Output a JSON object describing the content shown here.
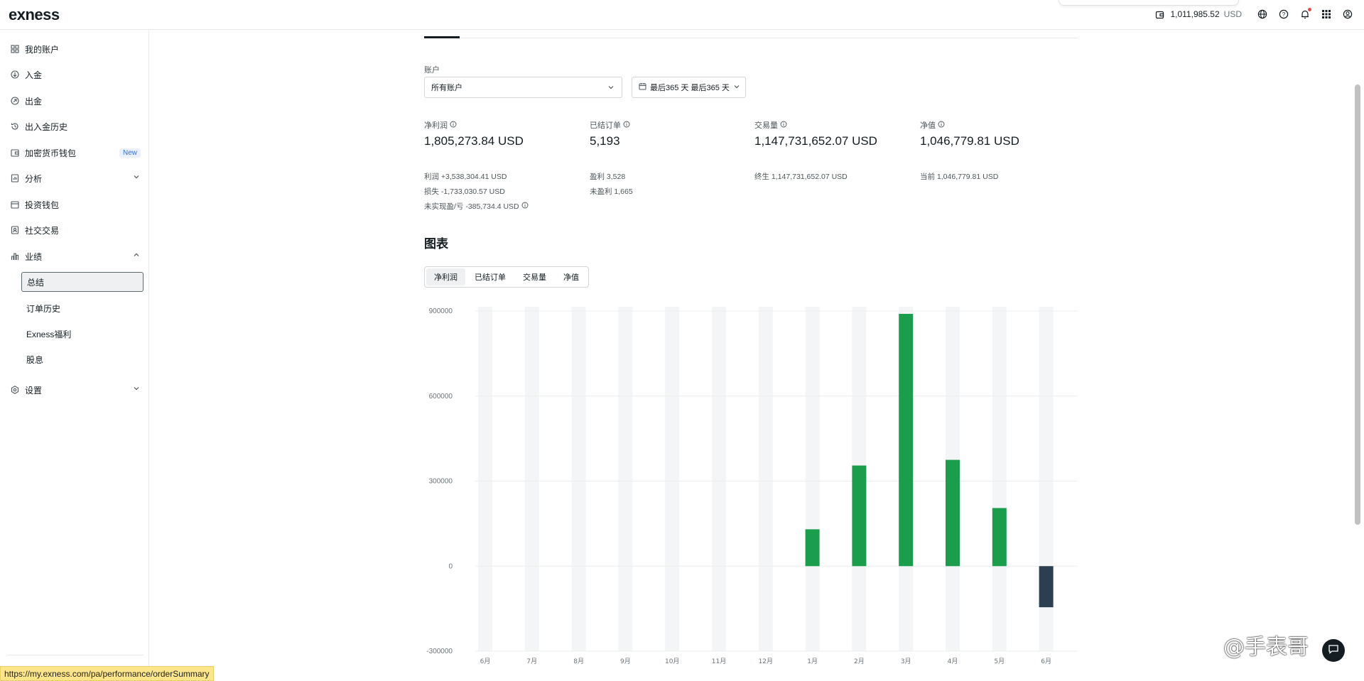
{
  "brand": "exness",
  "header": {
    "balance": "1,011,985.52",
    "currency": "USD",
    "icons": [
      "wallet-icon",
      "globe-icon",
      "help-icon",
      "bell-icon",
      "apps-grid-icon",
      "user-icon"
    ]
  },
  "sidebar": {
    "items": [
      {
        "label": "我的账户",
        "icon": "grid-icon"
      },
      {
        "label": "入金",
        "icon": "deposit-icon"
      },
      {
        "label": "出金",
        "icon": "withdraw-icon"
      },
      {
        "label": "出入金历史",
        "icon": "history-icon"
      },
      {
        "label": "加密货币钱包",
        "icon": "wallet-icon",
        "badge": "New"
      },
      {
        "label": "分析",
        "icon": "analysis-icon"
      },
      {
        "label": "投资钱包",
        "icon": "invest-wallet-icon"
      },
      {
        "label": "社交交易",
        "icon": "social-icon"
      },
      {
        "label": "业绩",
        "icon": "bar-chart-icon"
      },
      {
        "label": "设置",
        "icon": "settings-icon"
      }
    ],
    "sub_items": [
      "总结",
      "订单历史",
      "Exness福利",
      "股息"
    ]
  },
  "filters": {
    "account_label": "账户",
    "account_value": "所有账户",
    "date_range": "最后365 天 最后365 天"
  },
  "stats": {
    "net_profit": {
      "title": "净利润",
      "value": "1,805,273.84 USD",
      "lines": [
        "利润 +3,538,304.41 USD",
        "损失 -1,733,030.57 USD",
        "未实现盈/亏 -385,734.4 USD"
      ]
    },
    "closed_orders": {
      "title": "已结订单",
      "value": "5,193",
      "lines": [
        "盈利 3,528",
        "未盈利 1,665"
      ]
    },
    "volume": {
      "title": "交易量",
      "value": "1,147,731,652.07 USD",
      "lines": [
        "终生 1,147,731,652.07 USD"
      ]
    },
    "equity": {
      "title": "净值",
      "value": "1,046,779.81 USD",
      "lines": [
        "当前 1,046,779.81 USD"
      ]
    }
  },
  "chart_section": {
    "title": "图表",
    "tabs": [
      "净利润",
      "已结订单",
      "交易量",
      "净值"
    ],
    "active_tab": "净利润"
  },
  "chart_data": {
    "type": "bar",
    "categories": [
      "6月",
      "7月",
      "8月",
      "9月",
      "10月",
      "11月",
      "12月",
      "1月",
      "2月",
      "3月",
      "4月",
      "5月",
      "6月"
    ],
    "values": [
      0,
      0,
      0,
      0,
      0,
      0,
      0,
      130000,
      355000,
      890000,
      375000,
      205000,
      -145000
    ],
    "yticks": [
      900000,
      600000,
      300000,
      0,
      -300000
    ],
    "ylim": [
      -300000,
      900000
    ],
    "colors": {
      "positive": "#1a9e4b",
      "negative": "#2b3f50",
      "band": "#f4f5f6",
      "grid": "#ebedee"
    }
  },
  "status_url": "https://my.exness.com/pa/performance/orderSummary",
  "watermark": "@手表哥"
}
